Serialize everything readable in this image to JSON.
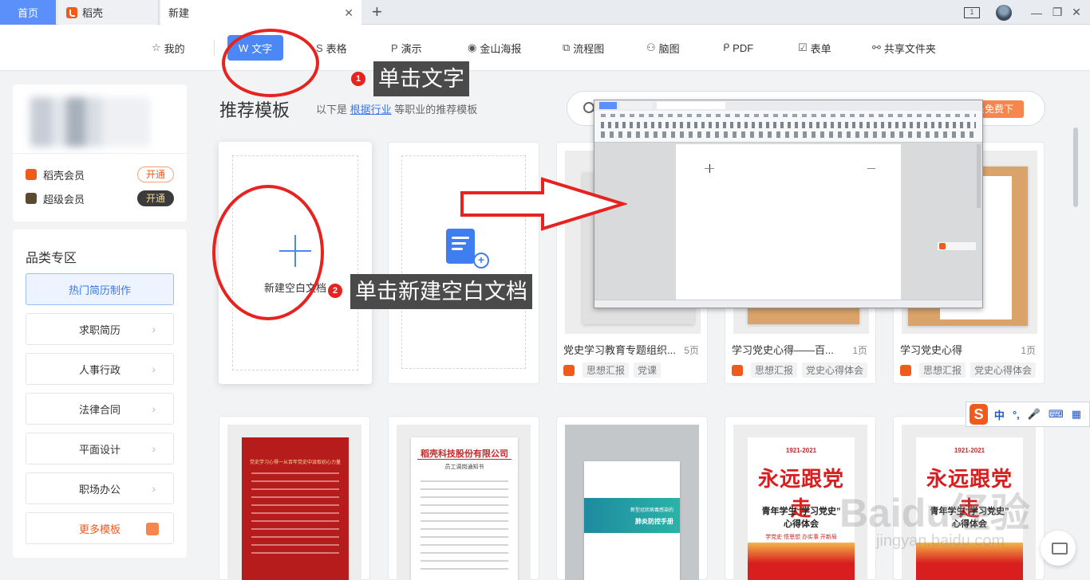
{
  "titlebar": {
    "tabs": [
      {
        "label": "首页"
      },
      {
        "label": "稻壳"
      },
      {
        "label": "新建"
      }
    ],
    "add_tab": "+",
    "screen_badge": "1",
    "icons": [
      "monitor-icon",
      "user-avatar-icon",
      "minimize-icon",
      "maximize-icon",
      "close-icon"
    ]
  },
  "catnav": {
    "items": [
      {
        "label": "我的",
        "icon": "☆"
      },
      {
        "label": "文字",
        "icon": "W"
      },
      {
        "label": "表格",
        "icon": "S"
      },
      {
        "label": "演示",
        "icon": "P"
      },
      {
        "label": "金山海报",
        "icon": "◉"
      },
      {
        "label": "流程图",
        "icon": "⧉"
      },
      {
        "label": "脑图",
        "icon": "⚇"
      },
      {
        "label": "PDF",
        "icon": "ᑭ"
      },
      {
        "label": "表单",
        "icon": "☑"
      },
      {
        "label": "共享文件夹",
        "icon": "⚯"
      }
    ],
    "active": "文字"
  },
  "sidebar": {
    "vip": [
      {
        "name": "稻壳会员",
        "button": "开通"
      },
      {
        "name": "超级会员",
        "button": "开通"
      }
    ],
    "categories_title": "品类专区",
    "categories": [
      {
        "label": "热门简历制作"
      },
      {
        "label": "求职简历"
      },
      {
        "label": "人事行政"
      },
      {
        "label": "法律合同"
      },
      {
        "label": "平面设计"
      },
      {
        "label": "职场办公"
      },
      {
        "label": "更多模板"
      }
    ]
  },
  "main": {
    "title": "推荐模板",
    "subtitle_prefix": "以下是",
    "subtitle_link": "根据行业",
    "subtitle_suffix": "等职业的推荐模板",
    "search_button": "员免费下",
    "new_blank_label": "新建空白文档",
    "templates": [
      {
        "title": "党史学习教育专题组织...",
        "pages": "5页",
        "tags": [
          "思想汇报",
          "党课"
        ]
      },
      {
        "title": "学习党史心得——百...",
        "pages": "1页",
        "tags": [
          "思想汇报",
          "党史心得体会"
        ]
      },
      {
        "title": "学习党史心得",
        "pages": "1页",
        "tags": [
          "思想汇报",
          "党史心得体会"
        ]
      }
    ],
    "bottom_templates": [
      {
        "poster_title": "党史学习心得一从百年党史中汲取初心力量"
      },
      {
        "company": "稻壳科技股份有限公司",
        "doc_title": "员工调岗通知书"
      },
      {
        "cover_title": "新型冠状病毒感染的",
        "cover_sub": "肺炎防控手册"
      },
      {
        "top": "1921-2021",
        "big": "永远跟党走",
        "sub": "青年学生“学习党史”",
        "sub2": "心得体会",
        "slogan": "学党史 悟思想 办实事 开新局"
      },
      {
        "top": "1921-2021",
        "big": "永远跟党走",
        "sub": "青年学生“学习党史”",
        "sub2": "心得体会"
      }
    ]
  },
  "annotations": {
    "step1_number": "1",
    "step1_text": "单击文字",
    "step2_number": "2",
    "step2_text": "单击新建空白文档"
  },
  "ime": {
    "logo": "S",
    "items": [
      "中",
      "°,",
      "🎤",
      "⌨",
      "▦"
    ]
  },
  "watermark": {
    "text": "Baidu经验",
    "sub": "jingyan.baidu.com"
  },
  "colors": {
    "accent": "#4b87f5",
    "brand_orange": "#f05a1a",
    "annotation_red": "#e6231f"
  }
}
